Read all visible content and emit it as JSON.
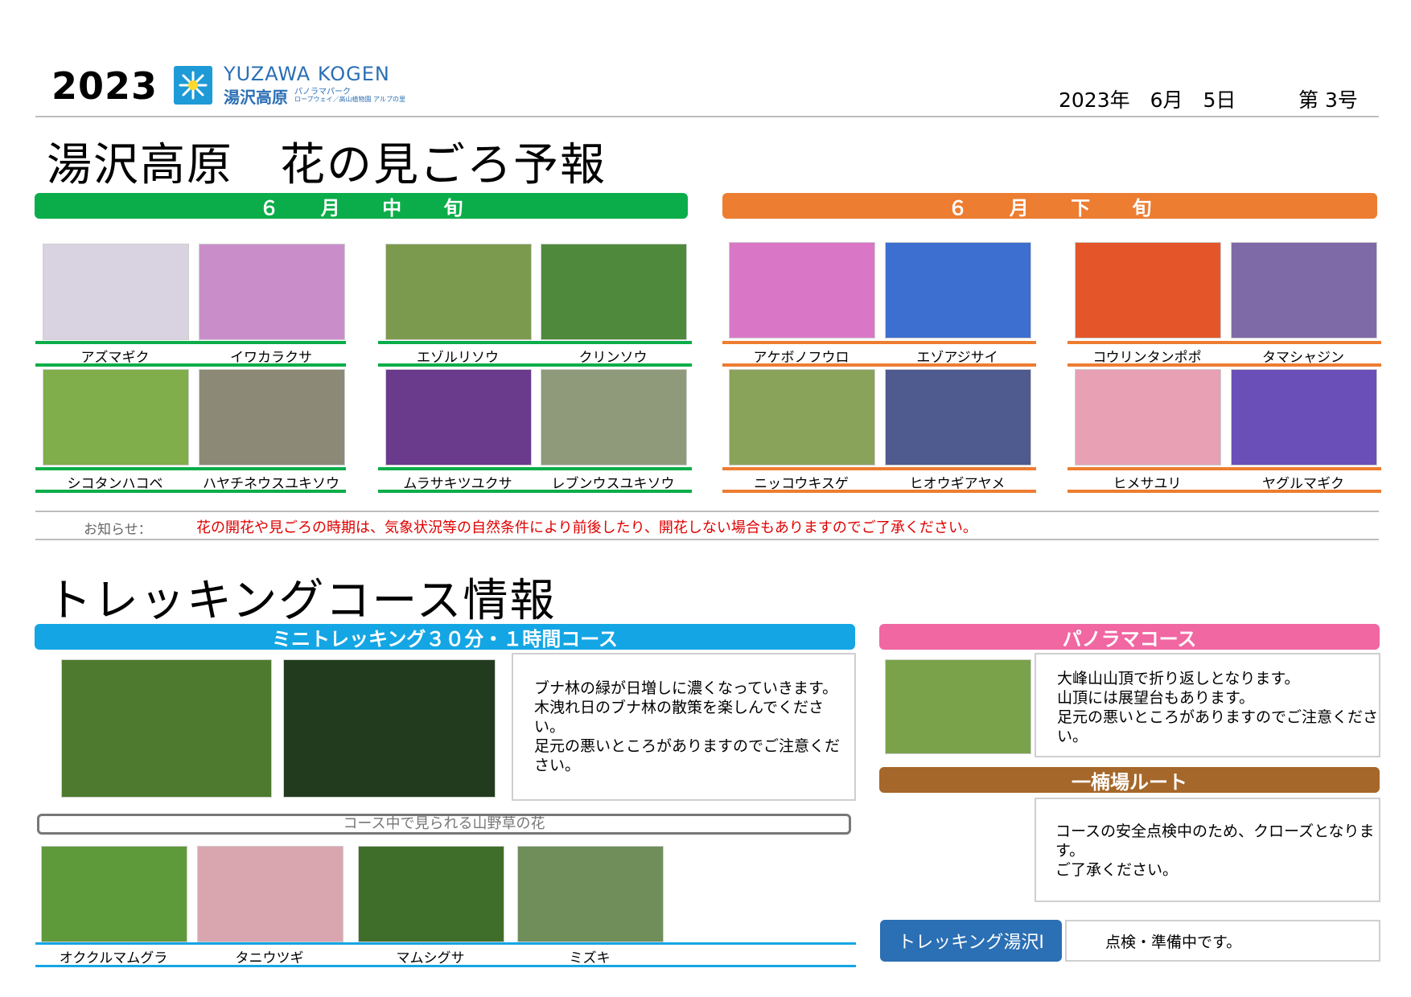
{
  "header": {
    "year": "2023",
    "logo_en": "YUZAWA KOGEN",
    "logo_ja": "湯沢高原",
    "logo_sub1": "パノラマパーク",
    "logo_sub2": "ロープウェイ／高山植物園 アルプの里",
    "issue_date": "2023年　6月　5日",
    "issue_no": "第 3号"
  },
  "flower_section": {
    "title": "湯沢高原　花の見ごろ予報",
    "mid_label": "６ 月 中 旬",
    "late_label": "６ 月 下 旬",
    "groups": [
      {
        "flowers": [
          {
            "name": "アズマギク",
            "color": "#d9d2e0"
          },
          {
            "name": "イワカラクサ",
            "color": "#c98ec9"
          },
          {
            "name": "シコタンハコベ",
            "color": "#7fae4a"
          },
          {
            "name": "ハヤチネウスユキソウ",
            "color": "#8c8a76"
          }
        ]
      },
      {
        "flowers": [
          {
            "name": "エゾルリソウ",
            "color": "#7c9a4e"
          },
          {
            "name": "クリンソウ",
            "color": "#4f8a3c"
          },
          {
            "name": "ムラサキツユクサ",
            "color": "#6a3a8c"
          },
          {
            "name": "レブンウスユキソウ",
            "color": "#8f9a7a"
          }
        ]
      },
      {
        "flowers": [
          {
            "name": "アケボノフウロ",
            "color": "#d977c6"
          },
          {
            "name": "エゾアジサイ",
            "color": "#3c6fcf"
          },
          {
            "name": "ニッコウキスゲ",
            "color": "#8aa35a"
          },
          {
            "name": "ヒオウギアヤメ",
            "color": "#4f5a8e"
          }
        ]
      },
      {
        "flowers": [
          {
            "name": "コウリンタンポポ",
            "color": "#e4562a"
          },
          {
            "name": "タマシャジン",
            "color": "#7f6aa8"
          },
          {
            "name": "ヒメサユリ",
            "color": "#e7a0b4"
          },
          {
            "name": "ヤグルマギク",
            "color": "#6b4fb8"
          }
        ]
      }
    ],
    "notice_label": "お知らせ：",
    "notice_text": "花の開花や見ごろの時期は、気象状況等の自然条件により前後したり、開花しない場合もありますのでご了承ください。"
  },
  "trekking": {
    "title": "トレッキングコース情報",
    "mini": {
      "label": "ミニトレッキング３０分・１時間コース",
      "text": "ブナ林の緑が日増しに濃くなっていきます。\n木洩れ日のブナ林の散策を楽しんでください。\n足元の悪いところがありますのでご注意ください。"
    },
    "wild_flowers_label": "コース中で見られる山野草の花",
    "wild_flowers": [
      {
        "name": "オククルマムグラ",
        "color": "#5f9a3a"
      },
      {
        "name": "タニウツギ",
        "color": "#d9a6b0"
      },
      {
        "name": "マムシグサ",
        "color": "#3f6e2a"
      },
      {
        "name": "ミズキ",
        "color": "#6f8e5a"
      }
    ],
    "panorama": {
      "label": "パノラマコース",
      "text": "大峰山山頂で折り返しとなります。\n山頂には展望台もあります。\n足元の悪いところがありますのでご注意ください。"
    },
    "ichinan": {
      "label": "一楠場ルート",
      "text": "コースの安全点検中のため、クローズとなります。\nご了承ください。"
    },
    "trekking_yuzawa": {
      "label": "トレッキング湯沢Ⅰ",
      "status": "点検・準備中です。"
    }
  },
  "colors": {
    "mid_june": "#0bad4a",
    "late_june": "#ed7d31",
    "mini_course": "#14a6e4",
    "panorama": "#f067a2",
    "ichinan": "#a5672a",
    "trekking_button": "#2b6fb4",
    "notice_text": "#e00000"
  }
}
